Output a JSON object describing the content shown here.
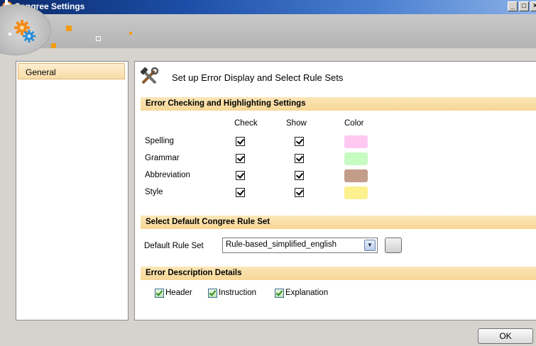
{
  "window": {
    "title": "Congree Settings",
    "minimize": "_",
    "maximize": "□",
    "close": "×"
  },
  "nav": {
    "items": [
      {
        "label": "General",
        "selected": true
      }
    ]
  },
  "main": {
    "header": "Set up Error Display and Select Rule Sets",
    "error_section": {
      "title": "Error Checking and Highlighting Settings",
      "columns": {
        "check": "Check",
        "show": "Show",
        "color": "Color"
      },
      "rows": [
        {
          "label": "Spelling",
          "check": true,
          "show": true,
          "color": "#fec8f3"
        },
        {
          "label": "Grammar",
          "check": true,
          "show": true,
          "color": "#c6fbc2"
        },
        {
          "label": "Abbreviation",
          "check": true,
          "show": true,
          "color": "#c29d8a"
        },
        {
          "label": "Style",
          "check": true,
          "show": true,
          "color": "#fdf08f"
        }
      ]
    },
    "rule_section": {
      "title": "Select Default Congree Rule Set",
      "label": "Default Rule Set",
      "selected": "Rule-based_simplified_english"
    },
    "details_section": {
      "title": "Error Description Details",
      "options": [
        {
          "label": "Header",
          "checked": true
        },
        {
          "label": "Instruction",
          "checked": true
        },
        {
          "label": "Explanation",
          "checked": true
        }
      ]
    }
  },
  "footer": {
    "ok_label": "OK"
  }
}
